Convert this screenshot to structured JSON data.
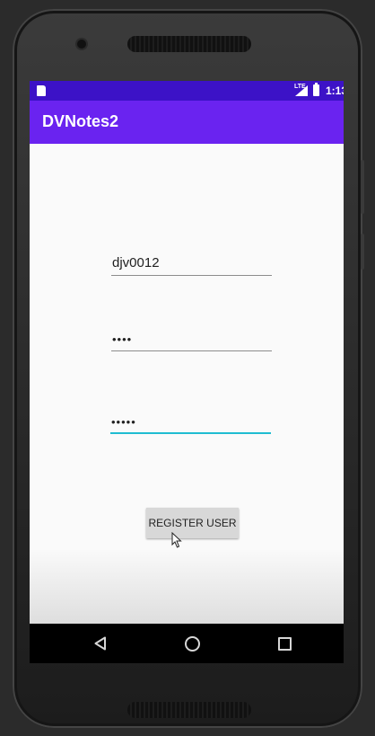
{
  "status_bar": {
    "network": "LTE",
    "time": "1:13",
    "icons": [
      "sd-card-icon",
      "signal-icon",
      "battery-icon"
    ]
  },
  "app_bar": {
    "title": "DVNotes2",
    "color": "#6a23f0"
  },
  "form": {
    "username": {
      "value": "djv0012"
    },
    "password": {
      "value": "••••"
    },
    "confirm_password": {
      "value": "•••••",
      "focused": true
    }
  },
  "register_button": {
    "label": "REGISTER USER"
  },
  "navigation_bar": {
    "icons": [
      "back-icon",
      "home-icon",
      "recents-icon"
    ]
  },
  "colors": {
    "status_bar": "#3c12c7",
    "accent": "#1fbcd1",
    "background": "#fafafa"
  }
}
